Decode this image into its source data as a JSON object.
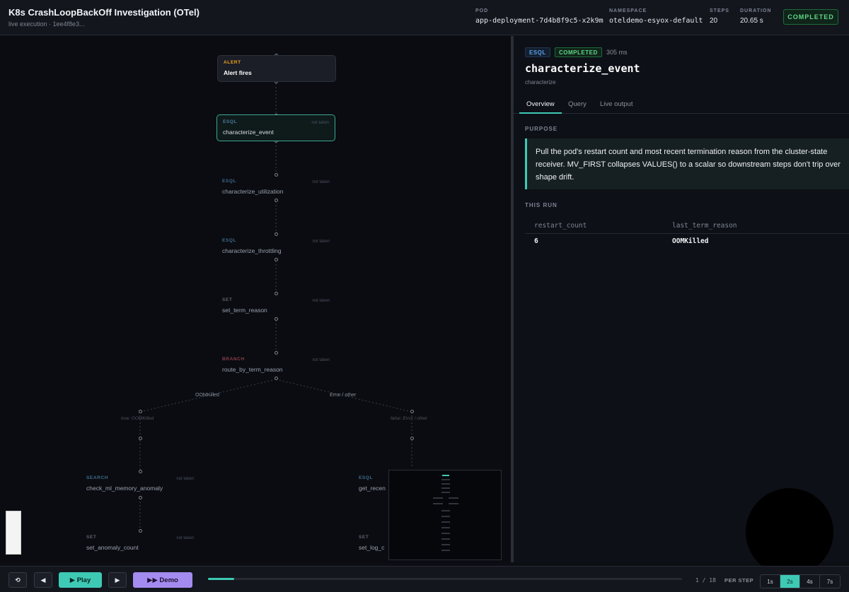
{
  "header": {
    "title": "K8s CrashLoopBackOff Investigation (OTel)",
    "subtitle": "live execution · 1ee4f8e3...",
    "meta": [
      {
        "key": "POD",
        "value": "app-deployment-7d4b8f9c5-x2k9m"
      },
      {
        "key": "NAMESPACE",
        "value": "oteldemo-esyox-default"
      },
      {
        "key": "STEPS",
        "value": "20"
      },
      {
        "key": "DURATION",
        "value": "20.65 s"
      }
    ],
    "status": "COMPLETED",
    "status_color": "#5fd88a"
  },
  "graph": {
    "nodes": [
      {
        "type": "ALERT",
        "name": "Alert fires",
        "state": ""
      },
      {
        "type": "ESQL",
        "name": "characterize_event",
        "state": "not taken"
      },
      {
        "type": "ESQL",
        "name": "characterize_utilization",
        "state": "not taken"
      },
      {
        "type": "ESQL",
        "name": "characterize_throttling",
        "state": "not taken"
      },
      {
        "type": "SET",
        "name": "set_term_reason",
        "state": "not taken"
      },
      {
        "type": "BRANCH",
        "name": "route_by_term_reason",
        "state": "not taken"
      },
      {
        "type": "SEARCH",
        "name": "check_ml_memory_anomaly",
        "state": "not taken"
      },
      {
        "type": "ESQL",
        "name": "get_recen",
        "state": ""
      },
      {
        "type": "SET",
        "name": "set_anomaly_count",
        "state": "not taken"
      },
      {
        "type": "SET",
        "name": "set_log_c",
        "state": ""
      }
    ],
    "edge_labels": {
      "left": "OOMKilled",
      "right": "Error / other",
      "left_cond": "true: OOMKilled",
      "right_cond": "false: Error / other"
    }
  },
  "panel": {
    "type_badge": "ESQL",
    "status_badge": "COMPLETED",
    "duration": "305 ms",
    "title": "characterize_event",
    "subtitle": "characterize",
    "tabs": [
      "Overview",
      "Query",
      "Live output"
    ],
    "active_tab": "Overview",
    "purpose_heading": "PURPOSE",
    "purpose_text": "Pull the pod's restart count and most recent termination reason from the cluster-state receiver. MV_FIRST collapses VALUES() to a scalar so downstream steps don't trip over shape drift.",
    "run_heading": "THIS RUN",
    "columns": [
      "restart_count",
      "last_term_reason"
    ],
    "rows": [
      [
        "6",
        "OOMKilled"
      ]
    ]
  },
  "footer": {
    "reset_icon": "reset-icon",
    "prev_icon": "step-back-icon",
    "play_label": "▶ Play",
    "next_icon": "step-forward-icon",
    "demo_label": "▶▶ Demo",
    "progress": 0.055,
    "counter": "1 / 18",
    "per_step_label": "PER STEP",
    "speeds": [
      "1s",
      "2s",
      "4s",
      "7s"
    ],
    "selected_speed": "2s",
    "accent": "#3ec9b5",
    "demo_color": "#a48bf0"
  }
}
